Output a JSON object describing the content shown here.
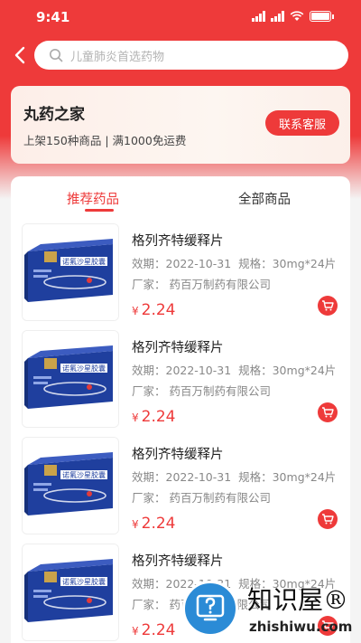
{
  "status": {
    "time": "9:41",
    "battery": "100%"
  },
  "search": {
    "placeholder": "儿童肺炎首选药物"
  },
  "store": {
    "name": "丸药之家",
    "meta": "上架150种商品 | 满1000免运费",
    "service_label": "联系客服"
  },
  "tabs": [
    {
      "label": "推荐药品",
      "active": true
    },
    {
      "label": "全部商品",
      "active": false
    }
  ],
  "products": [
    {
      "name": "格列齐特缓释片",
      "expiry": "效期：2022-10-31",
      "spec": "规格：30mg*24片",
      "maker": "厂家：  药百万制药有限公司",
      "currency": "¥",
      "price": "2.24",
      "package_text": "诺氟沙星胶囊"
    },
    {
      "name": "格列齐特缓释片",
      "expiry": "效期：2022-10-31",
      "spec": "规格：30mg*24片",
      "maker": "厂家：  药百万制药有限公司",
      "currency": "¥",
      "price": "2.24",
      "package_text": "诺氟沙星胶囊"
    },
    {
      "name": "格列齐特缓释片",
      "expiry": "效期：2022-10-31",
      "spec": "规格：30mg*24片",
      "maker": "厂家：  药百万制药有限公司",
      "currency": "¥",
      "price": "2.24",
      "package_text": "诺氟沙星胶囊"
    },
    {
      "name": "格列齐特缓释片",
      "expiry": "效期：2022-10-31",
      "spec": "规格：30mg*24片",
      "maker": "厂家：  药百万制药有限公司",
      "currency": "¥",
      "price": "2.24",
      "package_text": "诺氟沙星胶囊"
    }
  ],
  "watermark": {
    "title": "知识屋®",
    "url": "zhishiwu.com"
  },
  "colors": {
    "accent": "#ee3a3a",
    "package_blue": "#1f3f9e"
  },
  "icons": {
    "back": "chevron-left-icon",
    "search": "search-icon",
    "cart": "cart-icon"
  }
}
